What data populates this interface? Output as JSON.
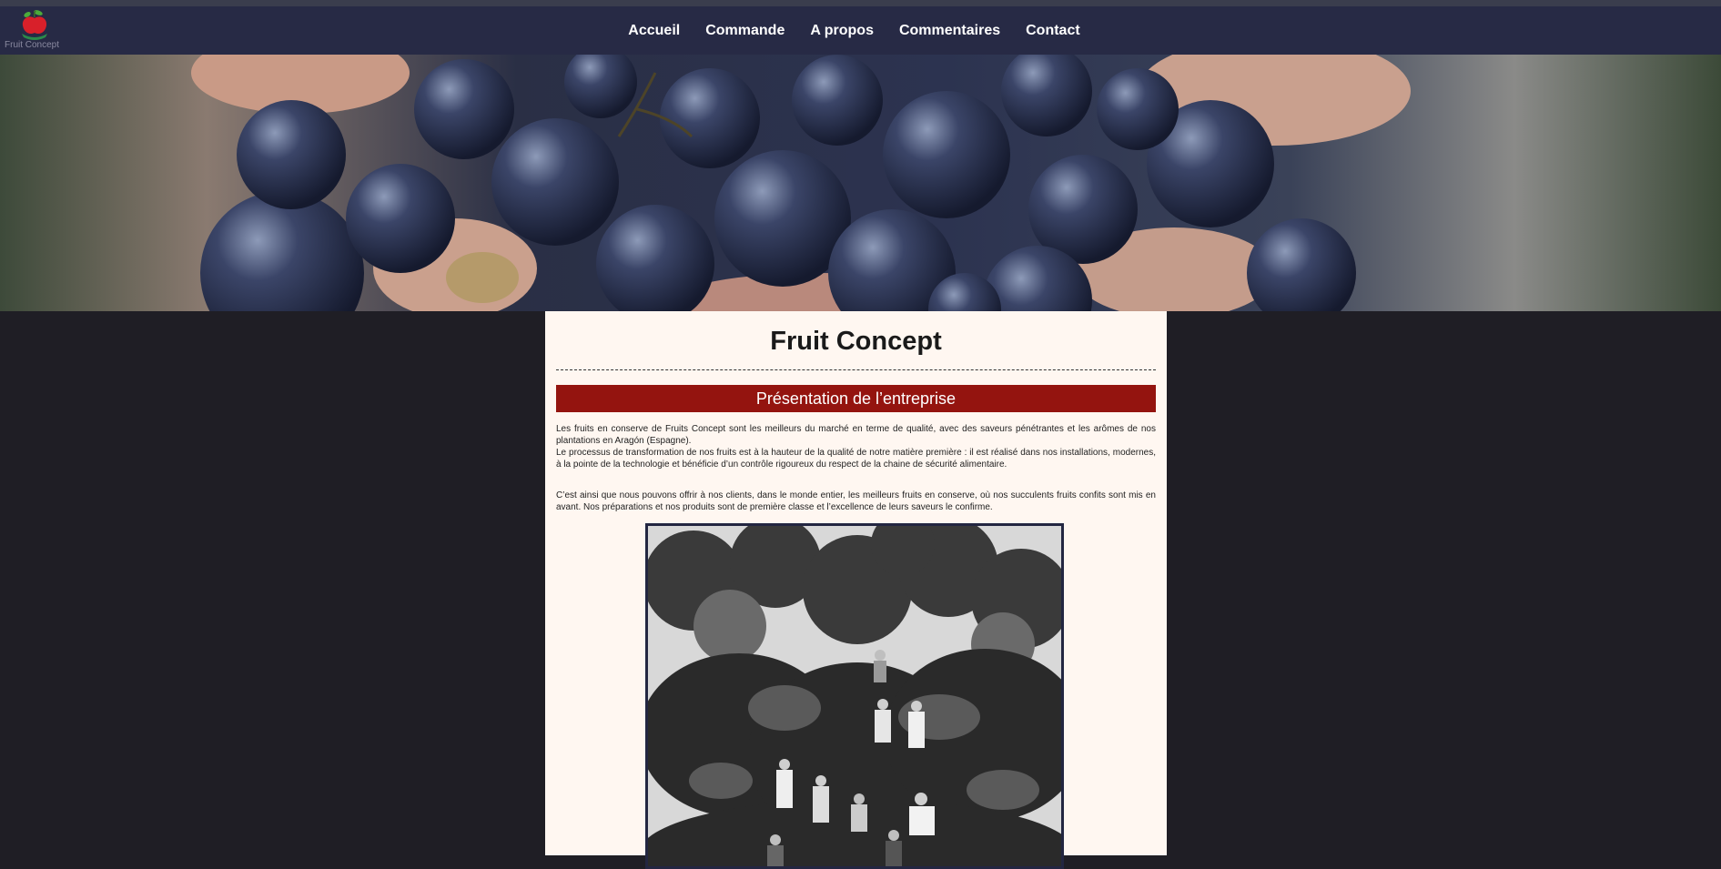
{
  "header": {
    "logo_text": "Fruit Concept",
    "nav": [
      {
        "label": "Accueil"
      },
      {
        "label": "Commande"
      },
      {
        "label": "A propos"
      },
      {
        "label": "Commentaires"
      },
      {
        "label": "Contact"
      }
    ]
  },
  "main": {
    "title": "Fruit Concept",
    "section_header": "Présentation de l’entreprise",
    "paragraphs": [
      "Les fruits en conserve de Fruits Concept sont les meilleurs du marché en terme de qualité, avec des saveurs pénétrantes et les arômes de nos plantations en Aragón (Espagne).",
      "Le processus de transformation de nos fruits est à la hauteur de la qualité de notre matière première : il est réalisé dans nos installations, modernes, à la pointe de la technologie et bénéficie d’un contrôle rigoureux du respect de la chaine de sécurité alimentaire.",
      "C’est ainsi que nous pouvons offrir à nos clients, dans le monde entier, les meilleurs fruits en conserve, où nos succulents fruits confits sont mis en avant. Nos préparations et nos produits sont de première classe et l’excellence de leurs saveurs le confirme."
    ]
  },
  "colors": {
    "navbar": "#272a45",
    "page_bg": "#1f1e25",
    "content_bg": "#fff7f1",
    "section_header_bg": "#94140f"
  }
}
